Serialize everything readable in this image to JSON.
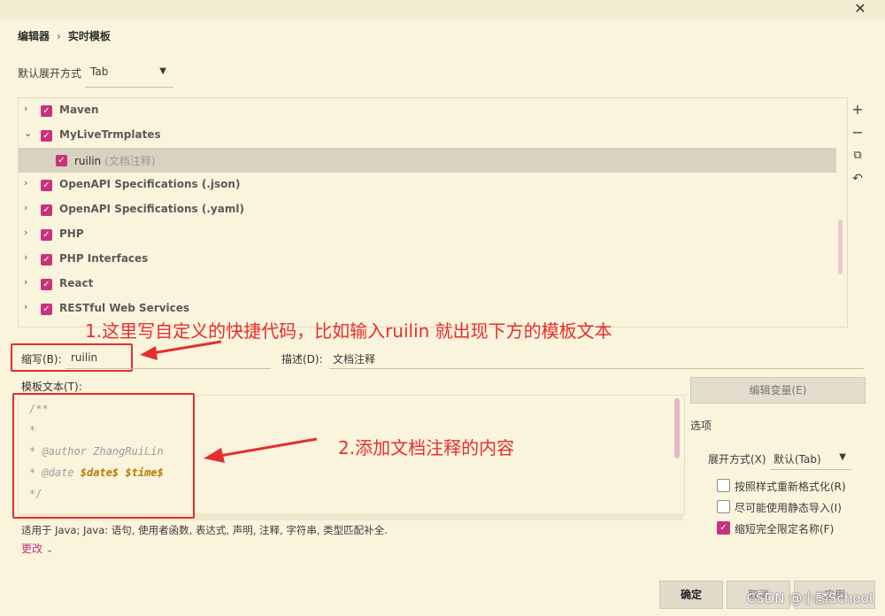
{
  "breadcrumb": {
    "parent": "编辑器",
    "current": "实时模板"
  },
  "expand_setting": {
    "label": "默认展开方式",
    "value": "Tab"
  },
  "tree": [
    {
      "label": "Maven",
      "expanded": false,
      "checked": true
    },
    {
      "label": "MyLiveTrmplates",
      "expanded": true,
      "checked": true
    },
    {
      "label": "ruilin",
      "desc": "(文档注释)",
      "child": true,
      "selected": true,
      "checked": true
    },
    {
      "label": "OpenAPI Specifications (.json)",
      "expanded": false,
      "checked": true
    },
    {
      "label": "OpenAPI Specifications (.yaml)",
      "expanded": false,
      "checked": true
    },
    {
      "label": "PHP",
      "expanded": false,
      "checked": true
    },
    {
      "label": "PHP Interfaces",
      "expanded": false,
      "checked": true
    },
    {
      "label": "React",
      "expanded": false,
      "checked": true
    },
    {
      "label": "RESTful Web Services",
      "expanded": false,
      "checked": true
    }
  ],
  "annotations": {
    "one": "1.这里写自定义的快捷代码，比如输入ruilin 就出现下方的模板文本",
    "two": "2.添加文档注释的内容"
  },
  "abbreviation": {
    "label": "缩写(B):",
    "value": "ruilin"
  },
  "description": {
    "label": "描述(D):",
    "value": "文档注释"
  },
  "template_text": {
    "label": "模板文本(T):",
    "lines": [
      {
        "text": "/**"
      },
      {
        "text": " *"
      },
      {
        "text": " * @author ZhangRuiLin"
      },
      {
        "prefix": " * @date ",
        "var1": "$date$",
        "var2": "$time$"
      },
      {
        "text": " */"
      }
    ]
  },
  "edit_variables": "编辑变量(E)",
  "options": {
    "title": "选项",
    "expand_label": "展开方式(X)",
    "expand_value": "默认(Tab)",
    "reformat": "按照样式重新格式化(R)",
    "static_import": "尽可能使用静态导入(I)",
    "shorten_fq": "缩短完全限定名称(F)"
  },
  "applicable": "适用于 Java; Java: 语句, 使用者函数, 表达式, 声明, 注释, 字符串, 类型匹配补全.",
  "change": "更改",
  "buttons": {
    "ok": "确定",
    "cancel": "取消",
    "apply": "应用"
  },
  "watermark": "CSDN @小麟School",
  "colors": {
    "accent": "#c8327c",
    "annotation": "#e52e2e",
    "background": "#fbf4dc"
  }
}
